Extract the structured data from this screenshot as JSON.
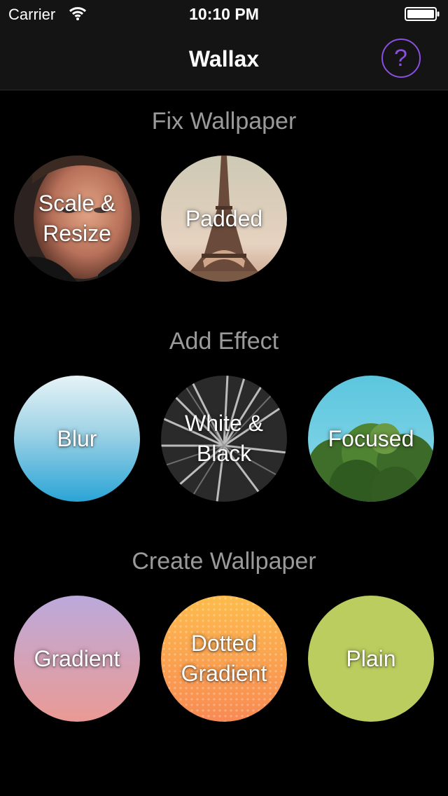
{
  "status_bar": {
    "carrier": "Carrier",
    "time": "10:10 PM",
    "wifi_icon": "wifi-icon",
    "battery_icon": "battery-icon"
  },
  "nav": {
    "title": "Wallax",
    "help_icon": "question-mark-icon",
    "help_label": "?",
    "accent_color": "#8a4fe0"
  },
  "sections": {
    "fix": {
      "title": "Fix Wallpaper",
      "items": [
        {
          "label": "Scale &\nResize"
        },
        {
          "label": "Padded"
        }
      ]
    },
    "effect": {
      "title": "Add Effect",
      "items": [
        {
          "label": "Blur"
        },
        {
          "label": "White &\nBlack"
        },
        {
          "label": "Focused"
        }
      ]
    },
    "create": {
      "title": "Create Wallpaper",
      "items": [
        {
          "label": "Gradient",
          "color": "#d4a2b8"
        },
        {
          "label": "Dotted\nGradient",
          "color": "#f9a04e"
        },
        {
          "label": "Plain",
          "color": "#bccd5f"
        }
      ]
    }
  }
}
